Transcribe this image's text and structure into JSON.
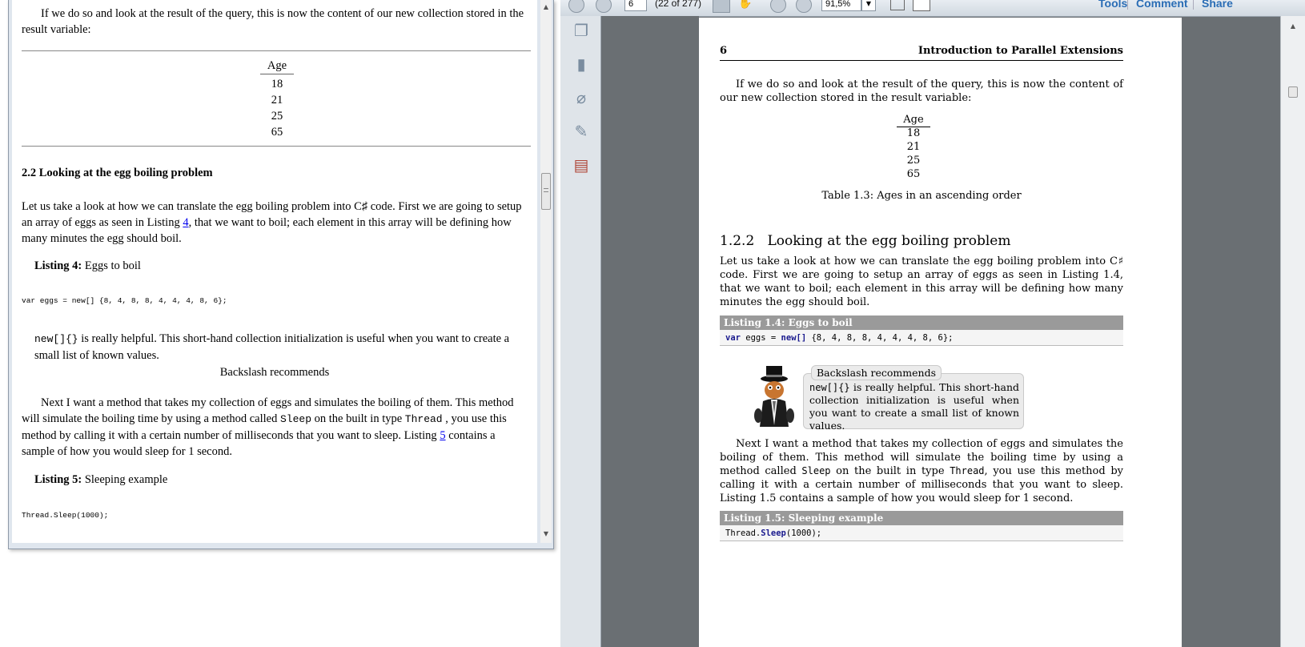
{
  "left": {
    "intro": "If we do so and look at the result of the query, this is now the content of our new collection stored in the result variable:",
    "table_header": "Age",
    "table_rows": [
      "18",
      "21",
      "25",
      "65"
    ],
    "section_heading": "2.2 Looking at the egg boiling problem",
    "para1_a": "Let us take a look at how we can translate the egg boiling problem into C♯  code. First we are going to setup an array of eggs as seen in Listing ",
    "para1_link": "4",
    "para1_b": ", that we want to boil; each element in this array will be defining how many minutes the egg should boil.",
    "listing4_label": "Listing 4:",
    "listing4_title": " Eggs to boil",
    "code1": "var eggs = new[] {8, 4, 8, 8, 4, 4, 4, 8, 6};",
    "tip_code": "new[]{}",
    "tip_text": " is really helpful. This short-hand collection initialization is useful when you want to create a small list of known values.",
    "tip_title": "Backslash recommends",
    "para2_a": "Next I want a method that takes my collection of eggs and simulates the boiling of them. This method will simulate the boiling time by using a method called ",
    "para2_code1": "Sleep",
    "para2_b": " on the built in type ",
    "para2_code2": "Thread",
    "para2_c": " , you use this method by calling it with a certain number of milliseconds that you want to sleep. Listing ",
    "para2_link": "5",
    "para2_d": " contains a sample of how you would sleep for 1 second.",
    "listing5_label": "Listing 5:",
    "listing5_title": " Sleeping example",
    "code2": "Thread.Sleep(1000);"
  },
  "toolbar": {
    "page_value": "6",
    "page_count": "(22 of 277)",
    "zoom_value": "91,5%",
    "tools_label": "Tools",
    "comment_label": "Comment",
    "share_label": "Share"
  },
  "pdf": {
    "page_number": "6",
    "running_title": "Introduction to Parallel Extensions",
    "intro": "If we do so and look at the result of the query, this is now the content of our new collection stored in the result variable:",
    "table_header": "Age",
    "table_rows": [
      "18",
      "21",
      "25",
      "65"
    ],
    "table_caption": "Table 1.3: Ages in an ascending order",
    "section_number": "1.2.2",
    "section_title": "Looking at the egg boiling problem",
    "para1": "Let us take a look at how we can translate the egg boiling problem into C♯ code. First we are going to setup an array of eggs as seen in Listing 1.4, that we want to boil; each element in this array will be defining how many minutes the egg should boil.",
    "listing4_head": "Listing 1.4: Eggs to boil",
    "code1_kw1": "var",
    "code1_mid": " eggs = ",
    "code1_kw2": "new[]",
    "code1_rest": " {8, 4, 8, 8, 4, 4, 4, 8, 6};",
    "tip_title": "Backslash recommends",
    "tip_code": "new[]{}",
    "tip_text": " is really helpful. This short-hand collection initialization is useful when you want to create a small list of known values.",
    "para2_a": "Next I want a method that takes my collection of eggs and simulates the boiling of them. This method will simulate the boiling time by using a method called ",
    "para2_code1": "Sleep",
    "para2_b": " on the built in type ",
    "para2_code2": "Thread",
    "para2_c": ", you use this method by calling it with a certain number of milliseconds that you want to sleep. Listing 1.5 contains a sample of how you would sleep for 1 second.",
    "listing5_head": "Listing 1.5: Sleeping example",
    "code2_a": "Thread.",
    "code2_kw": "Sleep",
    "code2_b": "(1000);"
  }
}
